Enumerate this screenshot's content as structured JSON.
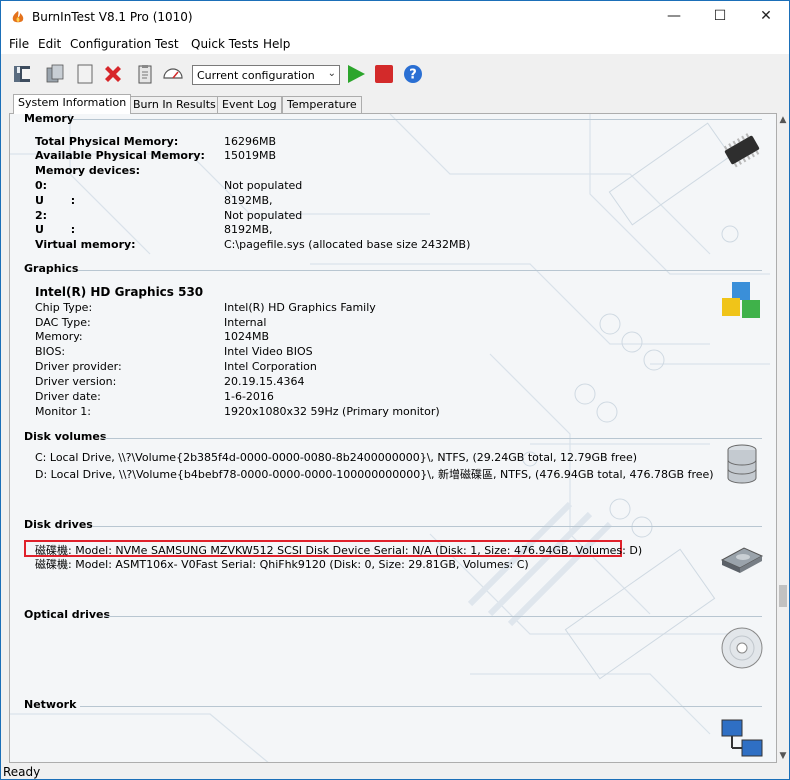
{
  "window": {
    "title": "BurnInTest V8.1 Pro (1010)",
    "minimize": "—",
    "maximize": "☐",
    "close": "✕"
  },
  "menu": [
    "File",
    "Edit",
    "Configuration",
    "Test",
    "Quick Tests",
    "Help"
  ],
  "toolbar": {
    "combo_value": "Current configuration"
  },
  "tabs": [
    "System Information",
    "Burn In Results",
    "Event Log",
    "Temperature"
  ],
  "memory": {
    "heading": "Memory",
    "rows": [
      {
        "label": "Total Physical Memory:",
        "value": "16296MB"
      },
      {
        "label": "Available Physical Memory:",
        "value": "15019MB"
      },
      {
        "label": "Memory devices:",
        "value": ""
      },
      {
        "label": "0:",
        "value": "Not populated"
      },
      {
        "label": "U       :",
        "value": "8192MB,"
      },
      {
        "label": "2:",
        "value": "Not populated"
      },
      {
        "label": "U       :",
        "value": "8192MB,"
      },
      {
        "label": "Virtual memory:",
        "value": "C:\\pagefile.sys (allocated base size 2432MB)"
      }
    ]
  },
  "graphics": {
    "heading": "Graphics",
    "device": "Intel(R) HD Graphics 530",
    "rows": [
      {
        "label": "Chip Type:",
        "value": "Intel(R) HD Graphics Family"
      },
      {
        "label": "DAC Type:",
        "value": "Internal"
      },
      {
        "label": "Memory:",
        "value": "1024MB"
      },
      {
        "label": "BIOS:",
        "value": "Intel Video BIOS"
      },
      {
        "label": "Driver provider:",
        "value": "Intel Corporation"
      },
      {
        "label": "Driver version:",
        "value": "20.19.15.4364"
      },
      {
        "label": "Driver date:",
        "value": "1-6-2016"
      },
      {
        "label": "Monitor 1:",
        "value": "1920x1080x32 59Hz (Primary monitor)"
      }
    ]
  },
  "disk_volumes": {
    "heading": "Disk volumes",
    "lines": [
      "C:  Local Drive, \\\\?\\Volume{2b385f4d-0000-0000-0080-8b2400000000}\\, NTFS, (29.24GB total, 12.79GB free)",
      "D:  Local Drive, \\\\?\\Volume{b4bebf78-0000-0000-0000-100000000000}\\, 新增磁碟區, NTFS, (476.94GB total, 476.78GB free)"
    ]
  },
  "disk_drives": {
    "heading": "Disk drives",
    "lines": [
      "磁碟機: Model: NVMe SAMSUNG MZVKW512 SCSI Disk Device Serial: N/A (Disk: 1, Size: 476.94GB, Volumes: D)",
      "磁碟機: Model: ASMT106x- V0Fast Serial: QhiFhk9120 (Disk: 0, Size: 29.81GB, Volumes: C)"
    ]
  },
  "optical": {
    "heading": "Optical drives"
  },
  "network": {
    "heading": "Network"
  },
  "status": "Ready",
  "colors": {
    "accent_border": "#1b6fb8",
    "highlight": "#e0212b",
    "play": "#2ca52c",
    "stop": "#d32a2a",
    "help": "#2a6fd3"
  }
}
